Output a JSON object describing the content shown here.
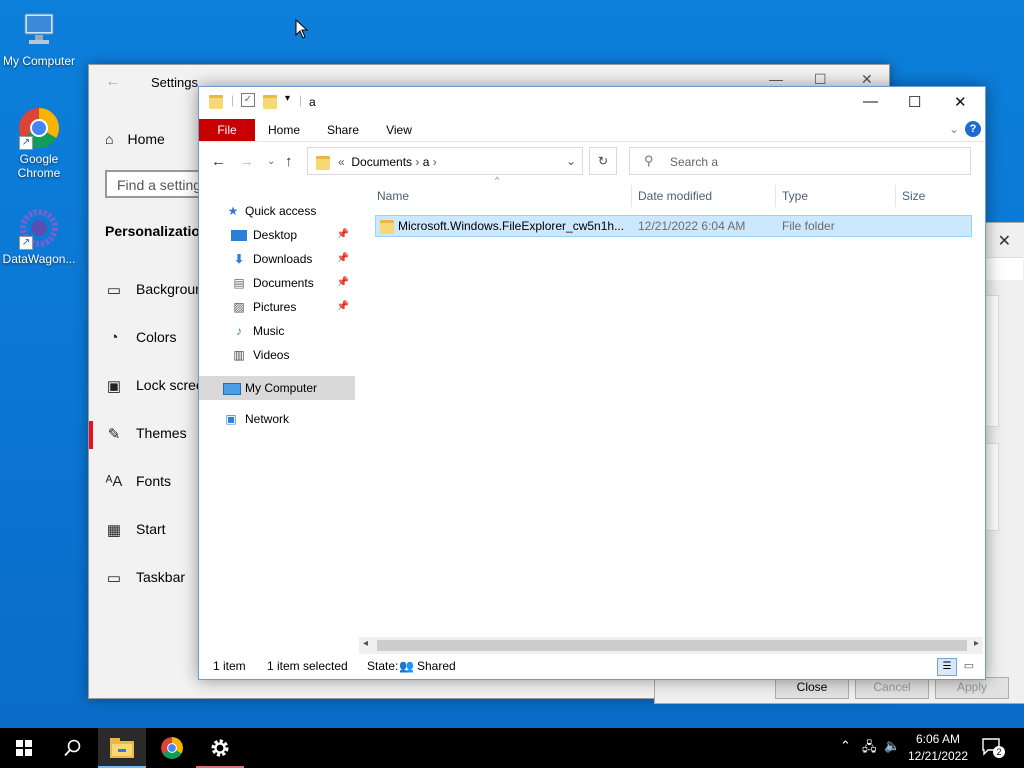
{
  "desktop": {
    "icons": [
      {
        "label": "My Computer"
      },
      {
        "label": "Google Chrome"
      },
      {
        "label": "DataWagon..."
      }
    ]
  },
  "settings": {
    "title": "Settings",
    "home_label": "Home",
    "search_placeholder": "Find a setting",
    "section": "Personalization",
    "nav": [
      {
        "label": "Background",
        "icon": "image-icon"
      },
      {
        "label": "Colors",
        "icon": "palette-icon"
      },
      {
        "label": "Lock screen",
        "icon": "lock-screen-icon"
      },
      {
        "label": "Themes",
        "icon": "themes-icon",
        "selected": true
      },
      {
        "label": "Fonts",
        "icon": "fonts-icon"
      },
      {
        "label": "Start",
        "icon": "start-icon"
      },
      {
        "label": "Taskbar",
        "icon": "taskbar-icon"
      }
    ]
  },
  "dialog": {
    "buttons": {
      "close": "Close",
      "cancel": "Cancel",
      "apply": "Apply"
    }
  },
  "explorer": {
    "title": "a",
    "tabs": {
      "file": "File",
      "home": "Home",
      "share": "Share",
      "view": "View"
    },
    "breadcrumb": {
      "prefix": "«",
      "parts": [
        "Documents",
        "a"
      ]
    },
    "search_placeholder": "Search a",
    "nav": {
      "quick_access": "Quick access",
      "items": [
        "Desktop",
        "Downloads",
        "Documents",
        "Pictures",
        "Music",
        "Videos"
      ],
      "my_computer": "My Computer",
      "network": "Network"
    },
    "columns": {
      "name": "Name",
      "date": "Date modified",
      "type": "Type",
      "size": "Size"
    },
    "rows": [
      {
        "name": "Microsoft.Windows.FileExplorer_cw5n1h...",
        "date": "12/21/2022 6:04 AM",
        "type": "File folder",
        "size": ""
      }
    ],
    "status": {
      "count": "1 item",
      "selected": "1 item selected",
      "state_label": "State:",
      "state_value": "Shared"
    }
  },
  "taskbar": {
    "time": "6:06 AM",
    "date": "12/21/2022",
    "notifications": "2"
  }
}
